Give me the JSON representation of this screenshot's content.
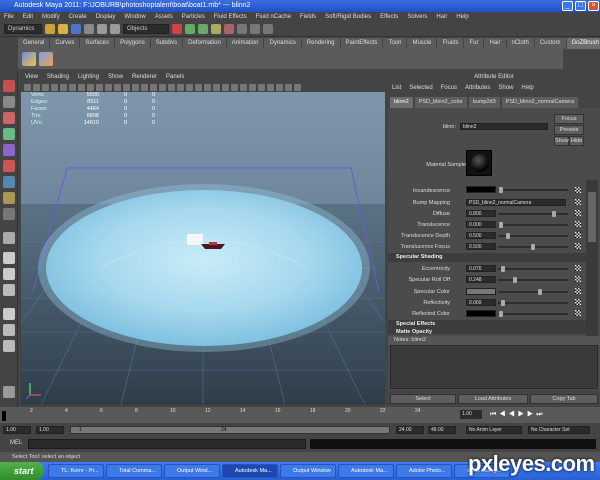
{
  "window": {
    "title": "Autodesk Maya 2011: F:\\JOBURB\\photoshoptalent\\boat\\boat1.mb* --- blinn2",
    "min": "_",
    "max": "□",
    "close": "×"
  },
  "menubar": [
    "File",
    "Edit",
    "Modify",
    "Create",
    "Display",
    "Window",
    "Assets",
    "Particles",
    "Fluid Effects",
    "Fluid nCache",
    "Fields",
    "Soft/Rigid Bodies",
    "Effects",
    "Solvers",
    "Hair",
    "Help"
  ],
  "status": {
    "mode": "Dynamics",
    "select_field": "Objects"
  },
  "shelf_tabs": [
    "General",
    "Curves",
    "Surfaces",
    "Polygons",
    "Subdivs",
    "Deformation",
    "Animation",
    "Dynamics",
    "Rendering",
    "PaintEffects",
    "Toon",
    "Muscle",
    "Fluids",
    "Fur",
    "Hair",
    "nCloth",
    "Custom",
    "GoZBrush"
  ],
  "shelf_active": "GoZBrush",
  "viewport": {
    "menu": [
      "View",
      "Shading",
      "Lighting",
      "Show",
      "Renderer",
      "Panels"
    ],
    "hud": [
      {
        "label": "Verts:",
        "a": "5500",
        "b": "0",
        "c": "0"
      },
      {
        "label": "Edges:",
        "a": "8911",
        "b": "0",
        "c": "0"
      },
      {
        "label": "Faces:",
        "a": "4464",
        "b": "0",
        "c": "0"
      },
      {
        "label": "Tris:",
        "a": "8808",
        "b": "0",
        "c": "0"
      },
      {
        "label": "UVs:",
        "a": "14610",
        "b": "0",
        "c": "0"
      }
    ]
  },
  "attr_editor": {
    "title": "Attribute Editor",
    "menu": [
      "List",
      "Selected",
      "Focus",
      "Attributes",
      "Show",
      "Help"
    ],
    "tabs": [
      "blinn2",
      "PSD_blinn2_color",
      "bump2d3",
      "PSD_blinn2_normalCamera"
    ],
    "active_tab": "blinn2",
    "node_label": "blinn:",
    "node_name": "blinn2",
    "focus": "Focus",
    "presets": "Presets",
    "show": "Show",
    "hide": "Hide",
    "material_sample": "Material Sample",
    "attrs": [
      {
        "label": "Incandescence",
        "value": ""
      },
      {
        "label": "Bump Mapping",
        "value": "PSD_blinn2_normalCamera"
      },
      {
        "label": "Diffuse",
        "value": "0.800"
      },
      {
        "label": "Translucence",
        "value": "0.000"
      },
      {
        "label": "Translucence Depth",
        "value": "0.500"
      },
      {
        "label": "Translucence Focus",
        "value": "0.500"
      }
    ],
    "spec_header": "Specular Shading",
    "spec_attrs": [
      {
        "label": "Eccentricity",
        "value": "0.076"
      },
      {
        "label": "Specular Roll Off",
        "value": "0.248"
      },
      {
        "label": "Specular Color",
        "value": ""
      },
      {
        "label": "Reflectivity",
        "value": "0.069"
      },
      {
        "label": "Reflected Color",
        "value": ""
      }
    ],
    "special_effects": "Special Effects",
    "matte_opacity": "Matte Opacity",
    "notes": "Notes: blinn2",
    "buttons": {
      "select": "Select",
      "load": "Load Attributes",
      "copy": "Copy Tab"
    }
  },
  "timeline": {
    "ticks": [
      "2",
      "4",
      "6",
      "8",
      "10",
      "12",
      "14",
      "16",
      "18",
      "20",
      "22",
      "24"
    ],
    "current": "1.00"
  },
  "range": {
    "start": "1.00",
    "start2": "1.00",
    "mid": "1",
    "mid2": "24",
    "end": "24.00",
    "end2": "48.00",
    "anim_layer": "No Anim Layer",
    "char_set": "No Character Set"
  },
  "mel": {
    "label": "MEL"
  },
  "helpline": "Select Tool: select an object",
  "taskbar": {
    "start": "start",
    "tasks": [
      "TL: Kornr - Pr...",
      "Total Comma...",
      "Output Wind...",
      "Autodesk Ma...",
      "Output Window",
      "Autodesk Ma...",
      "Adobe Photo...",
      "skrut..cshng..."
    ],
    "active_task": 3
  },
  "watermark": "pxleyes.com",
  "colors": {
    "accent_blue": "#3b6ee0",
    "maya_grey": "#444444",
    "plane_cyan": "#9ed7ef"
  }
}
